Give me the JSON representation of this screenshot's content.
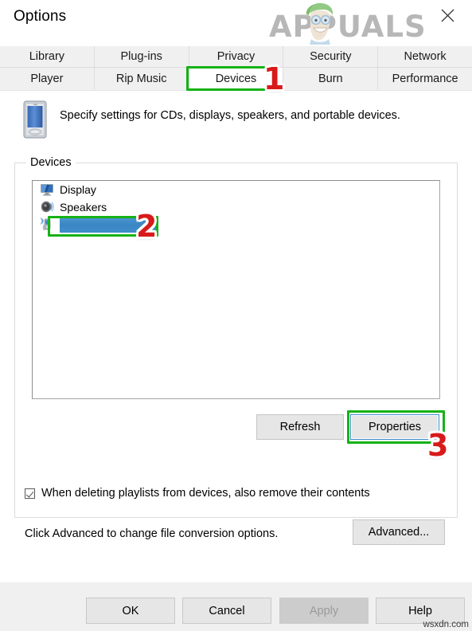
{
  "window": {
    "title": "Options",
    "close_icon": "close-icon"
  },
  "watermark": {
    "brand": "APPUALS",
    "site": "wsxdn.com"
  },
  "tabs": {
    "row1": [
      {
        "label": "Library",
        "selected": false
      },
      {
        "label": "Plug-ins",
        "selected": false
      },
      {
        "label": "Privacy",
        "selected": false
      },
      {
        "label": "Security",
        "selected": false
      },
      {
        "label": "Network",
        "selected": false
      }
    ],
    "row2": [
      {
        "label": "Player",
        "selected": false
      },
      {
        "label": "Rip Music",
        "selected": false
      },
      {
        "label": "Devices",
        "selected": true
      },
      {
        "label": "Burn",
        "selected": false
      },
      {
        "label": "Performance",
        "selected": false
      }
    ]
  },
  "main": {
    "header_icon": "portable-device-icon",
    "description": "Specify settings for CDs, displays, speakers, and portable devices.",
    "group_label": "Devices",
    "device_list": [
      {
        "label": "Display",
        "icon": "monitor-icon",
        "redacted": false,
        "selected": false
      },
      {
        "label": "Speakers",
        "icon": "speaker-icon",
        "redacted": false,
        "selected": false
      },
      {
        "label": "",
        "icon": "portable-player-icon",
        "redacted": true,
        "selected": true
      }
    ],
    "refresh_label": "Refresh",
    "properties_label": "Properties",
    "checkbox": {
      "label": "When deleting playlists from devices, also remove their contents",
      "checked": true
    },
    "advanced_text": "Click Advanced to change file conversion options.",
    "advanced_label": "Advanced..."
  },
  "footer": {
    "ok_label": "OK",
    "cancel_label": "Cancel",
    "apply_label": "Apply",
    "apply_enabled": false,
    "help_label": "Help"
  },
  "annotations": [
    {
      "number": "1",
      "target": "Devices tab"
    },
    {
      "number": "2",
      "target": "portable device list item"
    },
    {
      "number": "3",
      "target": "Properties button"
    }
  ],
  "colors": {
    "annotation_box": "#15b215",
    "annotation_number": "#d81a1a",
    "selection_blue": "#3f8dc9",
    "focus_border": "#3d8bcd",
    "chrome_gray": "#f0f0f0"
  }
}
